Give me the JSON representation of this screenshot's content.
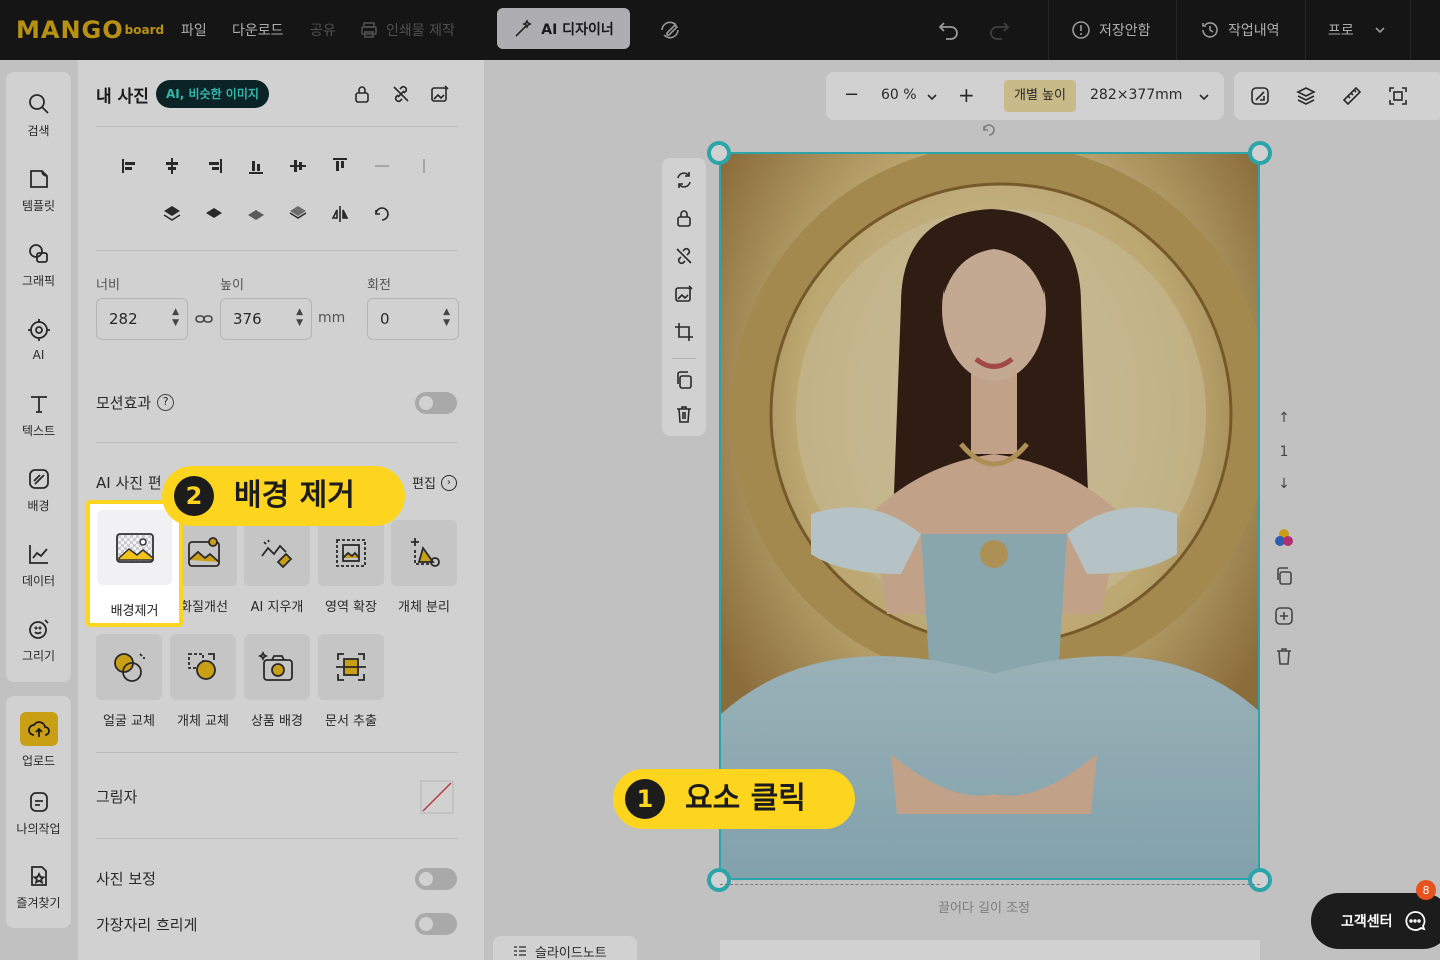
{
  "topbar": {
    "logo_main": "MANGO",
    "logo_sub": "board",
    "menu_file": "파일",
    "menu_download": "다운로드",
    "menu_share": "공유",
    "menu_print": "인쇄물 제작",
    "ai_designer": "AI 디자이너",
    "save_status": "저장안함",
    "history": "작업내역",
    "pro": "프로"
  },
  "sidebar": {
    "items": [
      {
        "label": "검색"
      },
      {
        "label": "템플릿"
      },
      {
        "label": "그래픽"
      },
      {
        "label": "AI"
      },
      {
        "label": "텍스트"
      },
      {
        "label": "배경"
      },
      {
        "label": "데이터"
      },
      {
        "label": "그리기"
      }
    ],
    "items2": [
      {
        "label": "업로드"
      },
      {
        "label": "나의작업"
      },
      {
        "label": "즐겨찾기"
      }
    ]
  },
  "panel": {
    "title": "내 사진",
    "badge": "AI, 비슷한 이미지",
    "width_label": "너비",
    "height_label": "높이",
    "rotate_label": "회전",
    "width_value": "282",
    "height_value": "376",
    "unit": "mm",
    "rotate_value": "0",
    "motion_label": "모션효과",
    "ai_edit_label": "AI 사진 편",
    "edit_link": "편집",
    "tools": [
      {
        "label": "배경제거"
      },
      {
        "label": "화질개선"
      },
      {
        "label": "AI 지우개"
      },
      {
        "label": "영역 확장"
      },
      {
        "label": "개체 분리"
      },
      {
        "label": "얼굴 교체"
      },
      {
        "label": "개체 교체"
      },
      {
        "label": "상품 배경"
      },
      {
        "label": "문서 추출"
      }
    ],
    "shadow_label": "그림자",
    "correction_label": "사진 보정",
    "blur_label": "가장자리 흐리게"
  },
  "zoom": {
    "value": "60 %",
    "individual_height": "개별 높이",
    "size": "282×377mm"
  },
  "canvas": {
    "drag_hint": "끌어다 길이 조정",
    "page_number": "1"
  },
  "steps": {
    "step1_num": "1",
    "step1_text": "요소 클릭",
    "step2_num": "2",
    "step2_text": "배경 제거"
  },
  "bottom": {
    "slide_note": "슬라이드노트",
    "customer_center": "고객센터",
    "notify_count": "8"
  },
  "colors": {
    "accent": "#f4c21a",
    "highlight": "#fed51e",
    "selection": "#35c9d0",
    "topbar": "#1c1c1d"
  }
}
